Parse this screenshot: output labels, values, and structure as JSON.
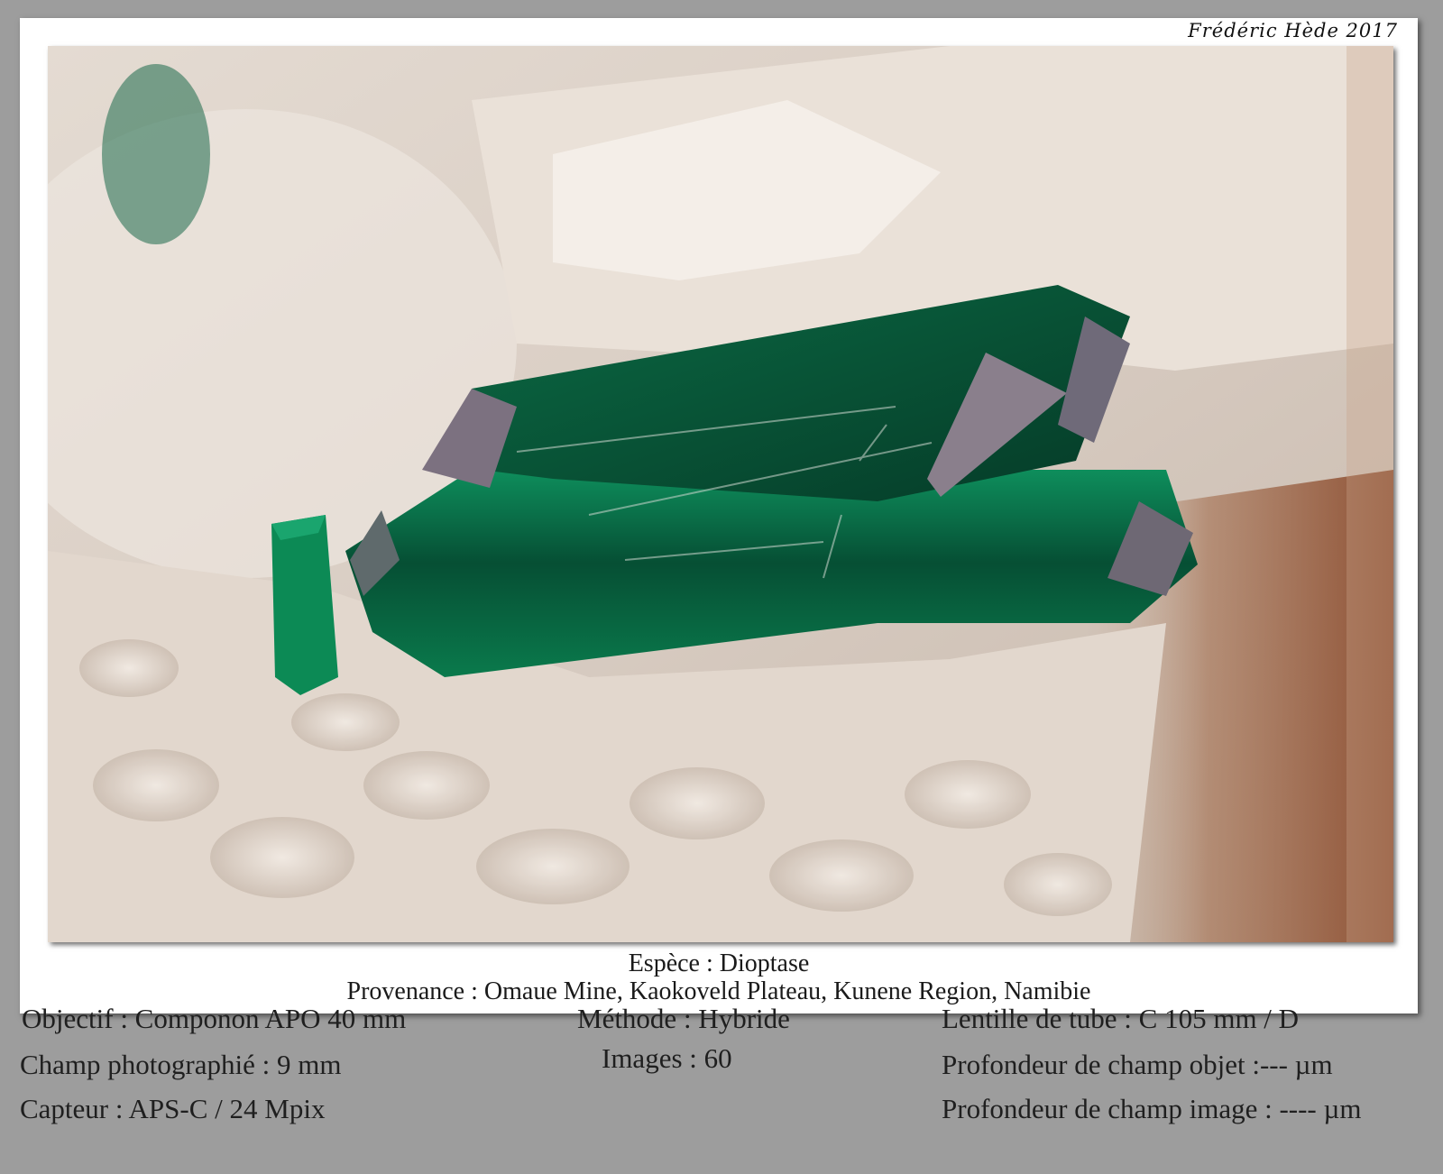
{
  "signature": "Frédéric Hède 2017",
  "caption": {
    "espece": "Espèce : Dioptase",
    "provenance": "Provenance : Omaue Mine, Kaokoveld Plateau, Kunene Region, Namibie"
  },
  "meta": {
    "objectif": "Objectif : Componon APO 40 mm",
    "champ": "Champ photographié : 9 mm",
    "capteur": "Capteur : APS-C / 24 Mpix",
    "methode": "Méthode : Hybride",
    "images": "Images : 60",
    "lentille": "Lentille de tube : C 105 mm / D",
    "profondeur_objet": "Profondeur de champ objet :--- µm",
    "profondeur_image": "Profondeur de champ image : ---- µm"
  },
  "colors": {
    "background": "#9d9d9d",
    "matrix": "#d9cdc2",
    "crystal": "#0c7a4e"
  }
}
